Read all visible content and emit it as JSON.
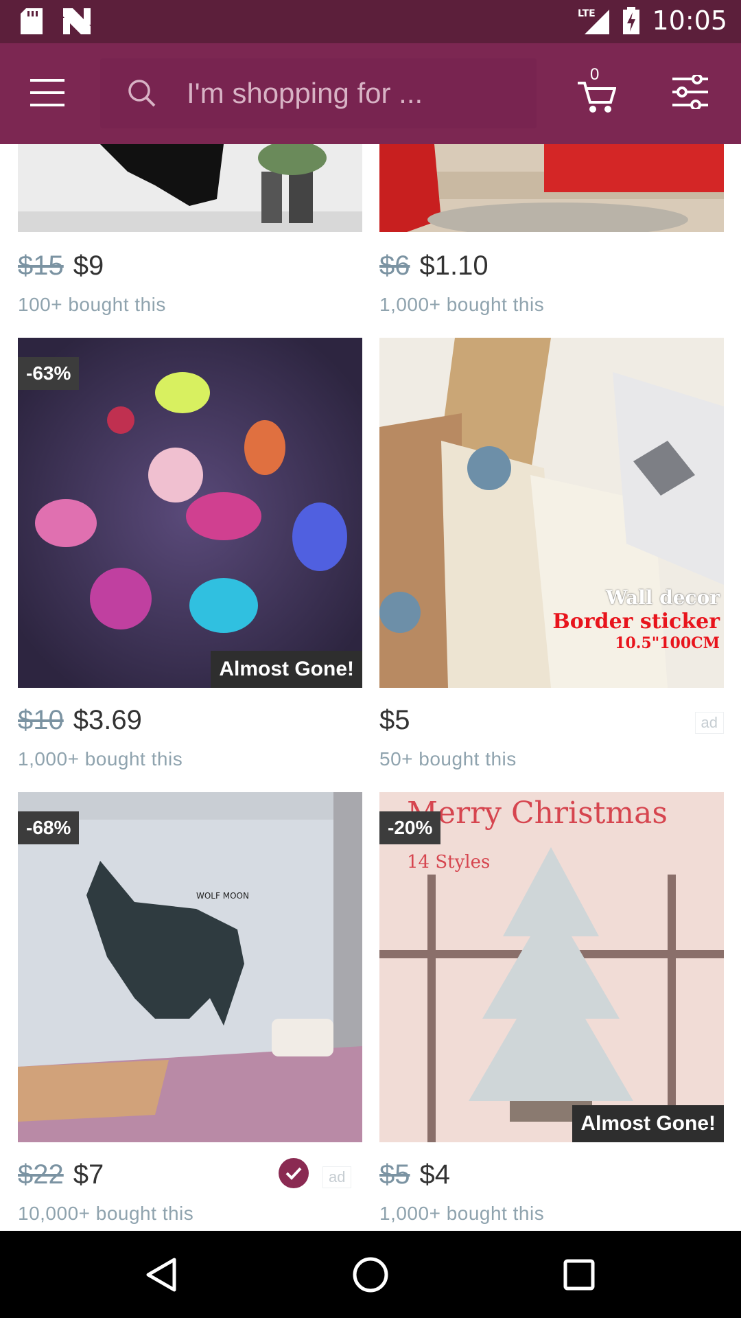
{
  "status_bar": {
    "network": "LTE",
    "time": "10:05"
  },
  "app_bar": {
    "search_placeholder": "I'm shopping for ...",
    "cart_count": "0",
    "accent_color": "#7c2752"
  },
  "products": [
    {
      "old_price": "$15",
      "price": "$9",
      "bought": "100+ bought this"
    },
    {
      "old_price": "$6",
      "price": "$1.10",
      "bought": "1,000+ bought this"
    },
    {
      "discount": "-63%",
      "badge": "Almost Gone!",
      "old_price": "$10",
      "price": "$3.69",
      "bought": "1,000+ bought this"
    },
    {
      "ad_tag": "ad",
      "price": "$5",
      "bought": "50+ bought this",
      "image_text": [
        "Wall decor",
        "Border sticker",
        "10.5\"100CM"
      ]
    },
    {
      "discount": "-68%",
      "ad_tag": "ad",
      "old_price": "$22",
      "price": "$7",
      "bought": "10,000+ bought this",
      "image_text": [
        "WOLF MOON"
      ]
    },
    {
      "discount": "-20%",
      "badge": "Almost Gone!",
      "old_price": "$5",
      "price": "$4",
      "bought": "1,000+ bought this",
      "image_text": [
        "Merry Christmas",
        "14 Styles"
      ]
    }
  ]
}
